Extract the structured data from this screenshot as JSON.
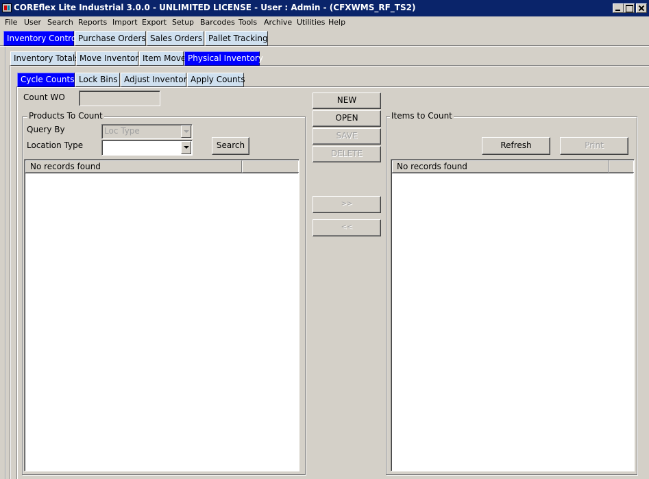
{
  "window": {
    "title": "COREflex Lite Industrial 3.0.0 - UNLIMITED LICENSE - User : Admin - (CFXWMS_RF_TS2)"
  },
  "menu": [
    "File",
    "User",
    "Search",
    "Reports",
    "Import",
    "Export",
    "Setup",
    "Barcodes",
    "Tools",
    "Archive",
    "Utilities",
    "Help"
  ],
  "main_tabs": [
    "Inventory Control",
    "Purchase Orders",
    "Sales Orders",
    "Pallet Tracking"
  ],
  "inventory_tabs": [
    "Inventory Totals",
    "Move Inventory",
    "Item Move",
    "Physical Inventory"
  ],
  "physical_tabs": [
    "Cycle Counts",
    "Lock Bins",
    "Adjust Inventory",
    "Apply Counts"
  ],
  "count_wo": {
    "label": "Count WO",
    "value": ""
  },
  "products_panel": {
    "title": "Products To Count",
    "query_by_label": "Query By",
    "query_by_value": "Loc Type",
    "location_type_label": "Location Type",
    "location_type_value": "",
    "search_label": "Search",
    "table_header": "No records found"
  },
  "actions": {
    "new": "NEW",
    "open": "OPEN",
    "save": "SAVE",
    "delete": "DELETE",
    "move_right": ">>",
    "move_left": "<<"
  },
  "items_panel": {
    "title": "Items to Count",
    "refresh_label": "Refresh",
    "print_label": "Print",
    "table_header": "No records found"
  },
  "colors": {
    "titlebar": "#0a246a",
    "active_tab": "#0000ff",
    "inactive_tab": "#cfe0ef",
    "face": "#d4d0c8"
  }
}
